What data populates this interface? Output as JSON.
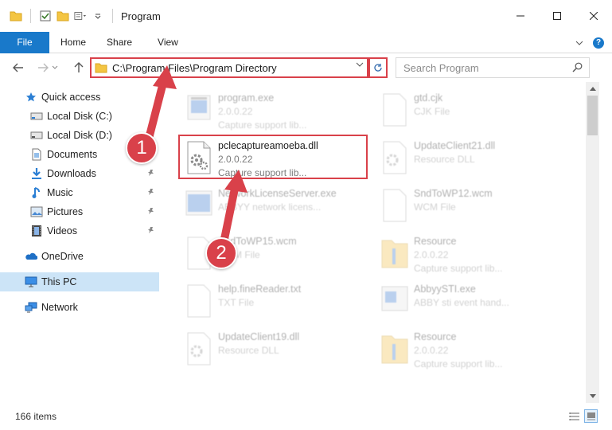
{
  "window": {
    "title": "Program"
  },
  "ribbon": {
    "tabs": [
      "File",
      "Home",
      "Share",
      "View"
    ],
    "help_label": "?"
  },
  "address": {
    "path": "C:\\Program Files\\Program Directory",
    "search_placeholder": "Search Program"
  },
  "sidebar": {
    "items": [
      {
        "label": "Quick access",
        "icon": "star-icon",
        "pinned": false
      },
      {
        "label": "Local Disk (C:)",
        "icon": "drive-icon",
        "pinned": false
      },
      {
        "label": "Local Disk (D:)",
        "icon": "drive-icon",
        "pinned": false
      },
      {
        "label": "Documents",
        "icon": "documents-icon",
        "pinned": true
      },
      {
        "label": "Downloads",
        "icon": "downloads-icon",
        "pinned": true
      },
      {
        "label": "Music",
        "icon": "music-icon",
        "pinned": true
      },
      {
        "label": "Pictures",
        "icon": "pictures-icon",
        "pinned": true
      },
      {
        "label": "Videos",
        "icon": "videos-icon",
        "pinned": true
      },
      {
        "label": "OneDrive",
        "icon": "onedrive-icon",
        "pinned": false
      },
      {
        "label": "This PC",
        "icon": "this-pc-icon",
        "pinned": false,
        "selected": true
      },
      {
        "label": "Network",
        "icon": "network-icon",
        "pinned": false
      }
    ]
  },
  "files": {
    "left": [
      {
        "name": "program.exe",
        "version": "2.0.0.22",
        "desc": "Capture support lib...",
        "icon": "exe-icon"
      },
      {
        "name": "pclecaptureamoeba.dll",
        "version": "2.0.0.22",
        "desc": "Capture support lib...",
        "icon": "dll-icon",
        "highlighted": true
      },
      {
        "name": "NetworkLicenseServer.exe",
        "version": "ABBYY network licens...",
        "desc": "",
        "icon": "exe-icon"
      },
      {
        "name": "SndToWP15.wcm",
        "version": "WCM File",
        "desc": "",
        "icon": "file-icon"
      },
      {
        "name": "help.fineReader.txt",
        "version": "TXT File",
        "desc": "",
        "icon": "file-icon"
      },
      {
        "name": "UpdateClient19.dll",
        "version": "Resource DLL",
        "desc": "",
        "icon": "dll-icon"
      }
    ],
    "right": [
      {
        "name": "gtd.cjk",
        "version": "CJK File",
        "desc": "",
        "icon": "file-icon"
      },
      {
        "name": "UpdateClient21.dll",
        "version": "Resource DLL",
        "desc": "",
        "icon": "dll-icon"
      },
      {
        "name": "SndToWP12.wcm",
        "version": "WCM File",
        "desc": "",
        "icon": "file-icon"
      },
      {
        "name": "Resource",
        "version": "2.0.0.22",
        "desc": "Capture support lib...",
        "icon": "archive-icon"
      },
      {
        "name": "AbbyySTI.exe",
        "version": "ABBY sti event hand...",
        "desc": "",
        "icon": "exe-icon"
      },
      {
        "name": "Resource",
        "version": "2.0.0.22",
        "desc": "Capture support lib...",
        "icon": "archive-icon"
      }
    ]
  },
  "status": {
    "count": "166 items"
  },
  "annotations": {
    "step1": "1",
    "step2": "2",
    "color": "#d9414a"
  }
}
